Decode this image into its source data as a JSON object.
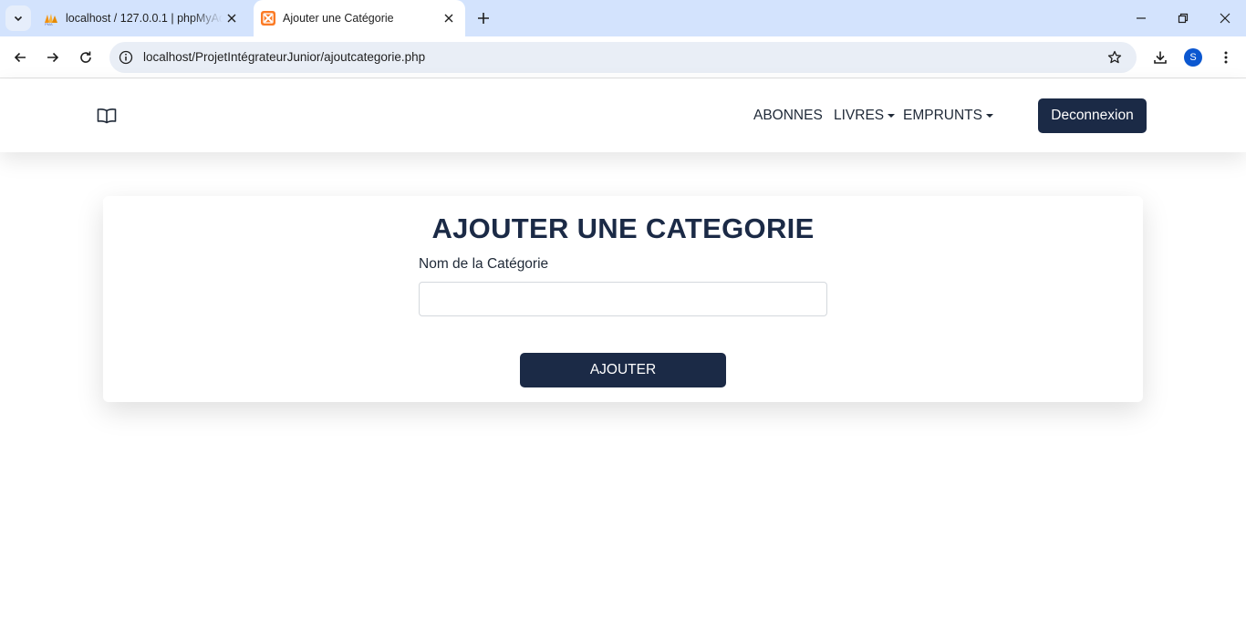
{
  "browser": {
    "tabs": [
      {
        "title": "localhost / 127.0.0.1 | phpMyAdmin",
        "favicon": "phpmyadmin-icon",
        "active": false
      },
      {
        "title": "Ajouter une Catégorie",
        "favicon": "xampp-icon",
        "active": true
      }
    ],
    "url": "localhost/ProjetIntégrateurJunior/ajoutcategorie.php",
    "profile_initial": "S",
    "accent_color": "#d3e3fd"
  },
  "site": {
    "brand_icon": "open-book-icon",
    "nav": {
      "abonnes": "ABONNES",
      "livres": "LIVRES",
      "emprunts": "EMPRUNTS"
    },
    "logout_label": "Deconnexion",
    "primary_color": "#1b2a46"
  },
  "form": {
    "title": "AJOUTER UNE CATEGORIE",
    "field_label": "Nom de la Catégorie",
    "field_value": "",
    "field_placeholder": "",
    "submit_label": "AJOUTER"
  }
}
